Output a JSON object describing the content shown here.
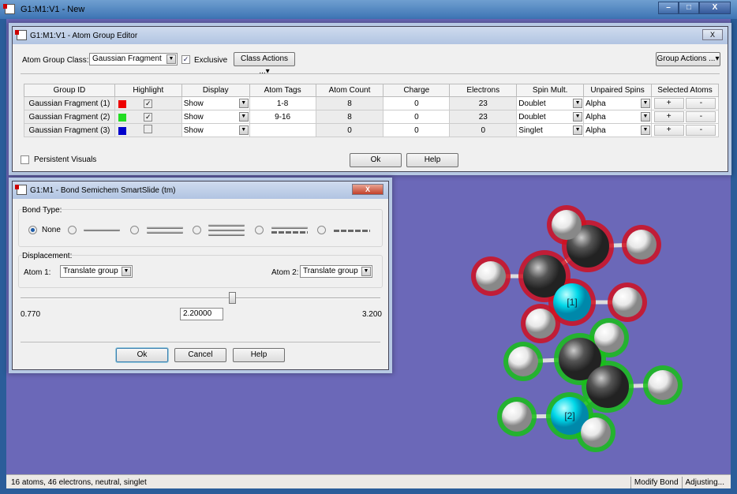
{
  "window": {
    "title": "G1:M1:V1 - New",
    "min": "–",
    "max": "□",
    "close": "X"
  },
  "status": {
    "summary": "16 atoms, 46 electrons, neutral, singlet",
    "mode": "Modify Bond",
    "state": "Adjusting..."
  },
  "age": {
    "title": "G1:M1:V1 - Atom Group Editor",
    "close": "X",
    "class_label": "Atom Group Class:",
    "class_value": "Gaussian Fragment",
    "exclusive_label": "Exclusive",
    "exclusive_checked": true,
    "class_actions": "Class Actions ...",
    "group_actions": "Group Actions ...",
    "columns": [
      "Group ID",
      "Highlight",
      "Display",
      "Atom Tags",
      "Atom Count",
      "Charge",
      "Electrons",
      "Spin Mult.",
      "Unpaired Spins",
      "Selected Atoms"
    ],
    "rows": [
      {
        "id": "Gaussian Fragment (1)",
        "color": "#ee0000",
        "highlight": true,
        "display": "Show",
        "tags": "1-8",
        "count": "8",
        "charge": "0",
        "electrons": "23",
        "spin": "Doublet",
        "unpaired": "Alpha",
        "plus": "+",
        "minus": "-"
      },
      {
        "id": "Gaussian Fragment (2)",
        "color": "#22dd22",
        "highlight": true,
        "display": "Show",
        "tags": "9-16",
        "count": "8",
        "charge": "0",
        "electrons": "23",
        "spin": "Doublet",
        "unpaired": "Alpha",
        "plus": "+",
        "minus": "-"
      },
      {
        "id": "Gaussian Fragment (3)",
        "color": "#0000cc",
        "highlight": false,
        "display": "Show",
        "tags": "",
        "count": "0",
        "charge": "0",
        "electrons": "0",
        "spin": "Singlet",
        "unpaired": "Alpha",
        "plus": "+",
        "minus": "-"
      }
    ],
    "persistent_label": "Persistent Visuals",
    "ok": "Ok",
    "help": "Help"
  },
  "smartslide": {
    "title": "G1:M1 - Bond Semichem SmartSlide (tm)",
    "close": "X",
    "bond_type_label": "Bond Type:",
    "none_label": "None",
    "bond_types": [
      "None",
      "Single",
      "Double",
      "Triple",
      "Aromatic",
      "Partial"
    ],
    "selected_bond": "None",
    "displacement_label": "Displacement:",
    "atom1_label": "Atom 1:",
    "atom1_value": "Translate group",
    "atom2_label": "Atom 2:",
    "atom2_value": "Translate group",
    "min": "0.770",
    "max": "3.200",
    "value": "2.20000",
    "slider_value": 2.2,
    "ok": "Ok",
    "cancel": "Cancel",
    "help": "Help"
  },
  "molecule": {
    "labels": {
      "a1": "[1]",
      "a2": "[2]"
    },
    "colors": {
      "carbon": "#555555",
      "hydrogen": "#e8e8e8",
      "tagged": "#00d8e8",
      "group1_glow": "#d01020",
      "group2_glow": "#18c018"
    }
  }
}
